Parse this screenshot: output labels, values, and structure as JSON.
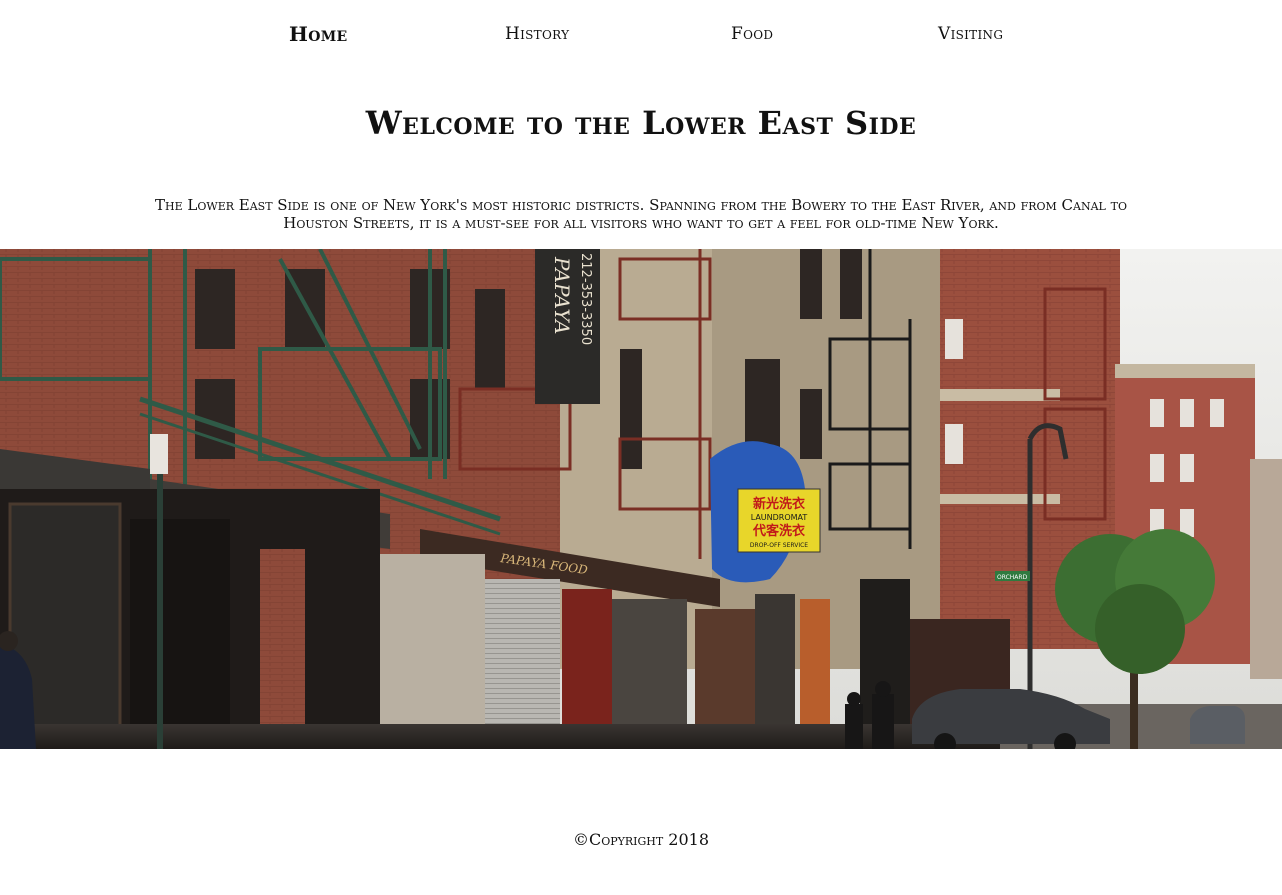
{
  "nav": {
    "items": [
      {
        "label": "Home",
        "active": true
      },
      {
        "label": "History",
        "active": false
      },
      {
        "label": "Food",
        "active": false
      },
      {
        "label": "Visiting",
        "active": false
      }
    ]
  },
  "main": {
    "title": "Welcome to the Lower East Side",
    "intro": "The Lower East Side is one of New York's most historic districts. Spanning from the Bowery to the East River, and from Canal to Houston Streets, it is a must-see for all visitors who want to get a feel for old-time New York."
  },
  "hero": {
    "papaya_sign": "PAPAYA",
    "phone": "212-353-3350",
    "laundromat_cn_top": "新光洗衣",
    "laundromat_en": "LAUNDROMAT",
    "laundromat_cn_bottom": "代客洗衣",
    "laundromat_service": "DROP-OFF SERVICE",
    "awning_text": "PAPAYA FOOD",
    "street_sign": "ORCHARD"
  },
  "footer": {
    "copyright": "©Copyright 2018"
  },
  "colors": {
    "text": "#111111",
    "background": "#ffffff",
    "brick": "#8e4a3a",
    "fire_escape_green": "#2f5a47",
    "laundromat_yellow": "#e8d62a",
    "tarp_blue": "#2a5bb8"
  }
}
